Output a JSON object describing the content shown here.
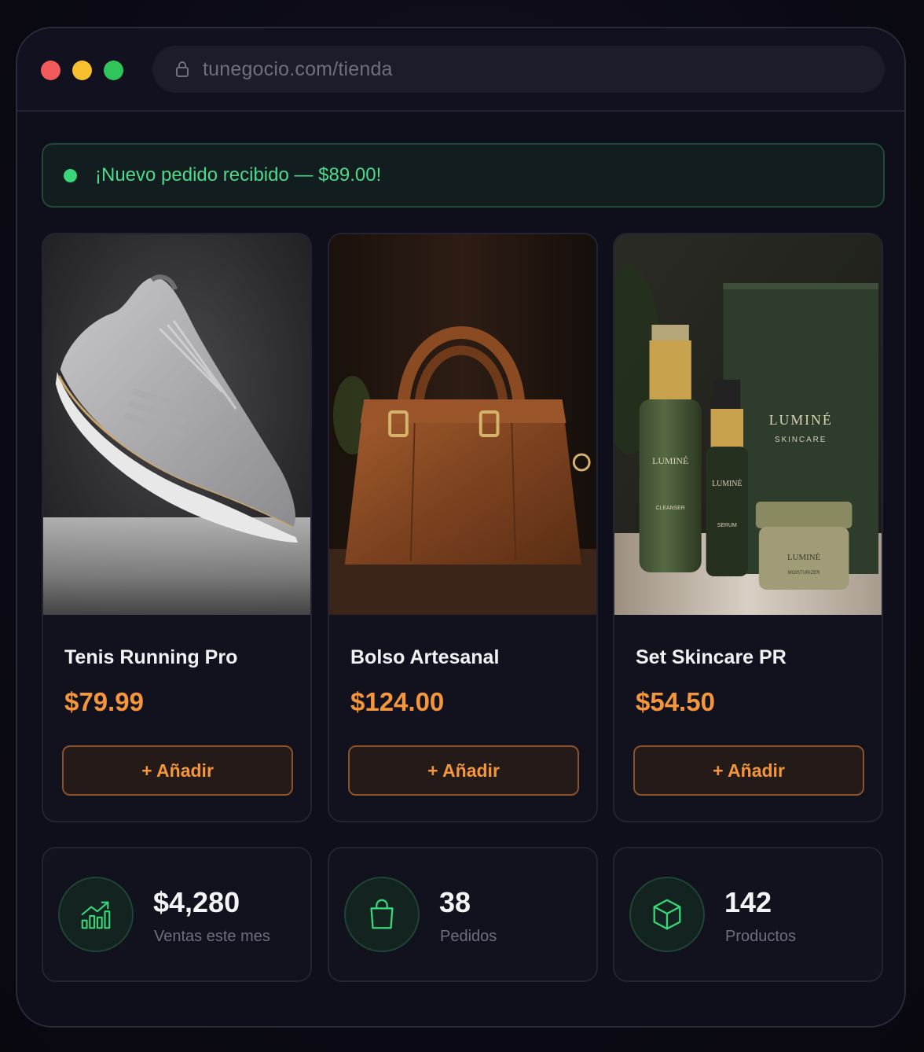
{
  "browser": {
    "url": "tunegocio.com/tienda"
  },
  "notification": {
    "message": "¡Nuevo pedido recibido — $89.00!",
    "color": "#38d77a"
  },
  "products": [
    {
      "name": "Tenis Running Pro",
      "price": "$79.99",
      "button": "+ Añadir",
      "image": "sneaker"
    },
    {
      "name": "Bolso Artesanal",
      "price": "$124.00",
      "button": "+ Añadir",
      "image": "handbag"
    },
    {
      "name": "Set Skincare PR",
      "price": "$54.50",
      "button": "+ Añadir",
      "image": "skincare"
    }
  ],
  "skincare_branding": {
    "brand": "LUMINÉ",
    "sub": "SKINCARE",
    "cleanser": "CLEANSER",
    "serum": "SERUM",
    "moisturizer": "MOISTURIZER"
  },
  "stats": [
    {
      "value": "$4,280",
      "label": "Ventas este mes",
      "icon": "chart-up-icon"
    },
    {
      "value": "38",
      "label": "Pedidos",
      "icon": "shopping-bag-icon"
    },
    {
      "value": "142",
      "label": "Productos",
      "icon": "box-icon"
    }
  ],
  "colors": {
    "accent": "#f5963a",
    "success": "#38d77a",
    "background": "#0f0f1b"
  }
}
